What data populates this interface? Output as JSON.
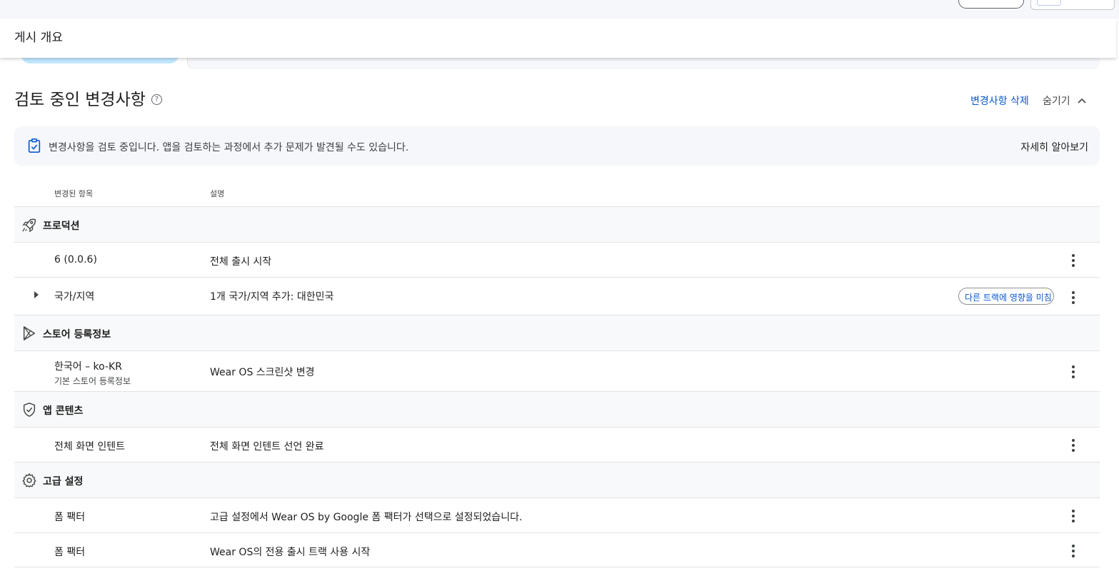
{
  "header": {
    "title": "게시 개요"
  },
  "section": {
    "title": "검토 중인 변경사항",
    "delete_label": "변경사항 삭제",
    "hide_label": "숨기기"
  },
  "banner": {
    "text": "변경사항을 검토 중입니다. 앱을 검토하는 과정에서 추가 문제가 발견될 수도 있습니다.",
    "learn_more": "자세히 알아보기"
  },
  "columns": {
    "changed_item": "변경된 항목",
    "description": "설명"
  },
  "groups": [
    {
      "label": "프로덕션",
      "icon": "rocket-icon",
      "items": [
        {
          "name": "6 (0.0.6)",
          "desc": "전체 출시 시작"
        },
        {
          "name": "국가/지역",
          "desc": "1개 국가/지역 추가: 대한민국",
          "chip": "다른 트랙에 영향을 미침"
        }
      ]
    },
    {
      "label": "스토어 등록정보",
      "icon": "play-store-icon",
      "items": [
        {
          "name": "한국어 – ko-KR",
          "sub": "기본 스토어 등록정보",
          "desc": "Wear OS 스크린샷 변경"
        }
      ]
    },
    {
      "label": "앱 콘텐츠",
      "icon": "shield-check-icon",
      "items": [
        {
          "name": "전체 화면 인텐트",
          "desc": "전체 화면 인텐트 선언 완료"
        }
      ]
    },
    {
      "label": "고급 설정",
      "icon": "gear-icon",
      "items": [
        {
          "name": "폼 팩터",
          "desc": "고급 설정에서 Wear OS by Google 폼 팩터가 선택으로 설정되었습니다."
        },
        {
          "name": "폼 팩터",
          "desc": "Wear OS의 전용 출시 트랙 사용 시작"
        }
      ]
    }
  ],
  "colors": {
    "accent": "#0b57d0",
    "banner_bg": "#f6f7fb",
    "category_bg": "#f8f9fa",
    "divider": "#e3e3e3"
  }
}
